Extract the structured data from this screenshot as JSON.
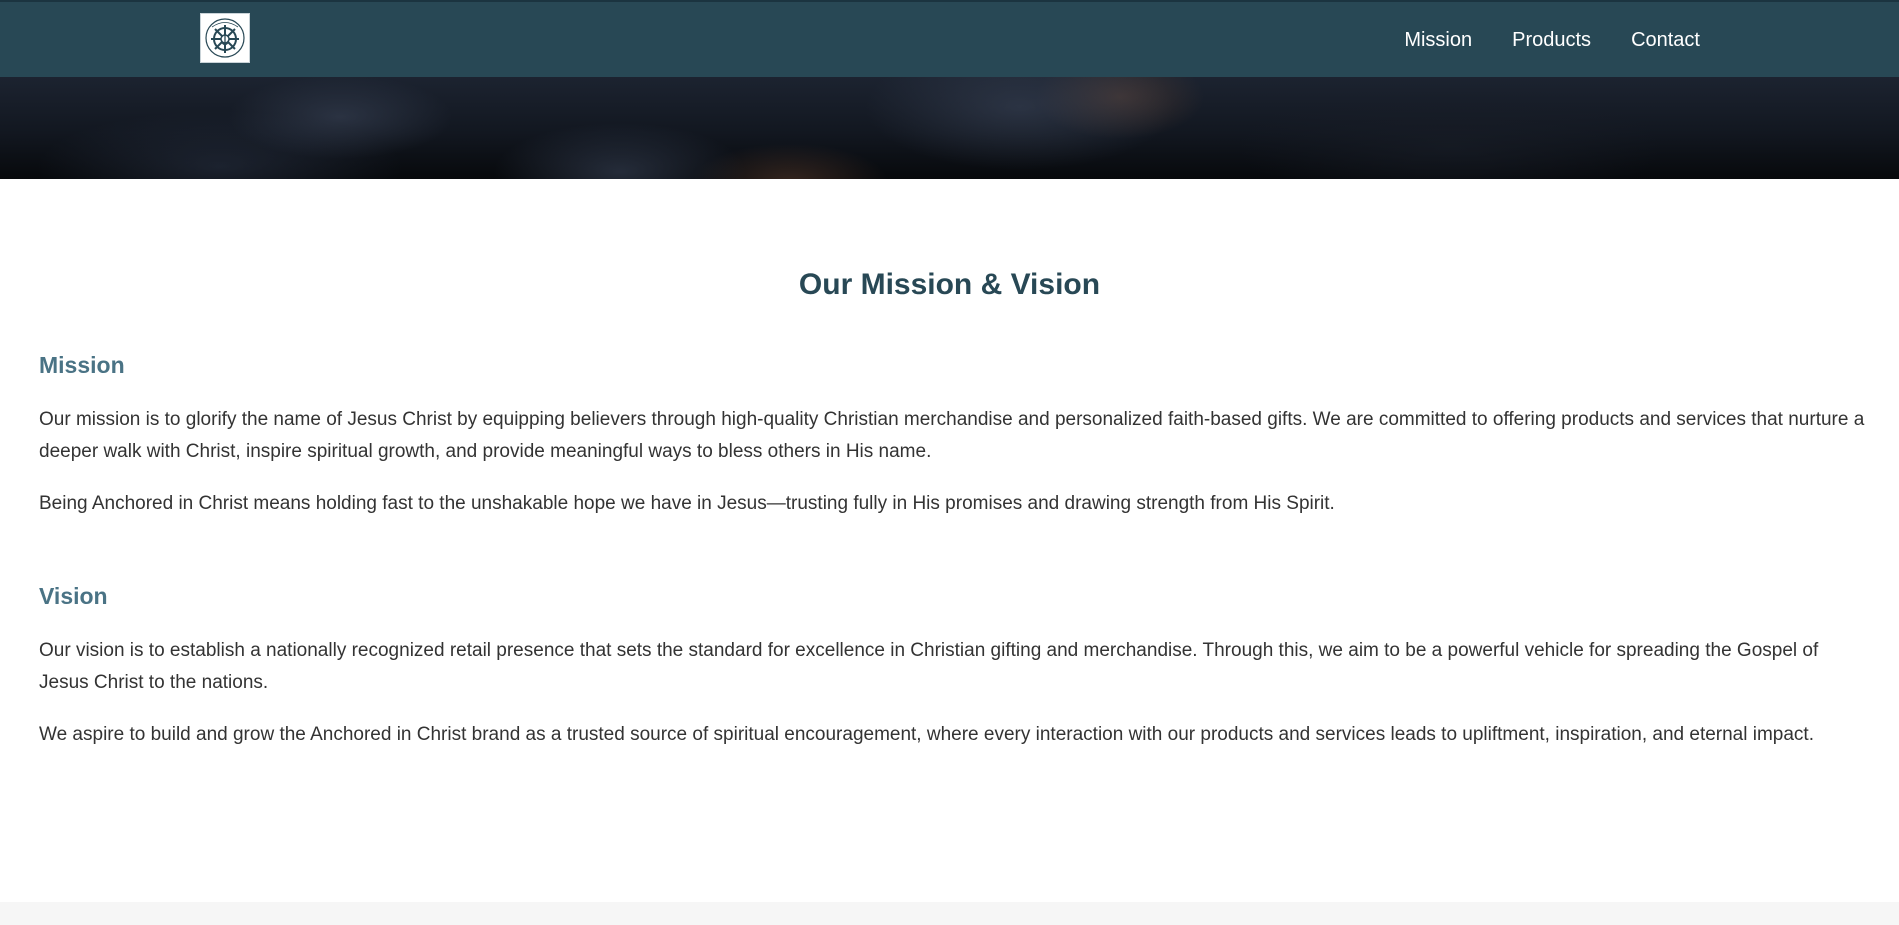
{
  "header": {
    "logo_alt": "Anchored in Christ",
    "nav": [
      "Mission",
      "Products",
      "Contact"
    ]
  },
  "colors": {
    "header_bg": "#284855",
    "title": "#284855",
    "subheading": "#4a7385",
    "body_text": "#333333"
  },
  "main": {
    "title": "Our Mission & Vision",
    "mission": {
      "heading": "Mission",
      "p1": "Our mission is to glorify the name of Jesus Christ by equipping believers through high-quality Christian merchandise and personalized faith-based gifts. We are committed to offering products and services that nurture a deeper walk with Christ, inspire spiritual growth, and provide meaningful ways to bless others in His name.",
      "p2": "Being Anchored in Christ means holding fast to the unshakable hope we have in Jesus—trusting fully in His promises and drawing strength from His Spirit."
    },
    "vision": {
      "heading": "Vision",
      "p1": "Our vision is to establish a nationally recognized retail presence that sets the standard for excellence in Christian gifting and merchandise. Through this, we aim to be a powerful vehicle for spreading the Gospel of Jesus Christ to the nations.",
      "p2": "We aspire to build and grow the Anchored in Christ brand as a trusted source of spiritual encouragement, where every interaction with our products and services leads to upliftment, inspiration, and eternal impact."
    }
  }
}
